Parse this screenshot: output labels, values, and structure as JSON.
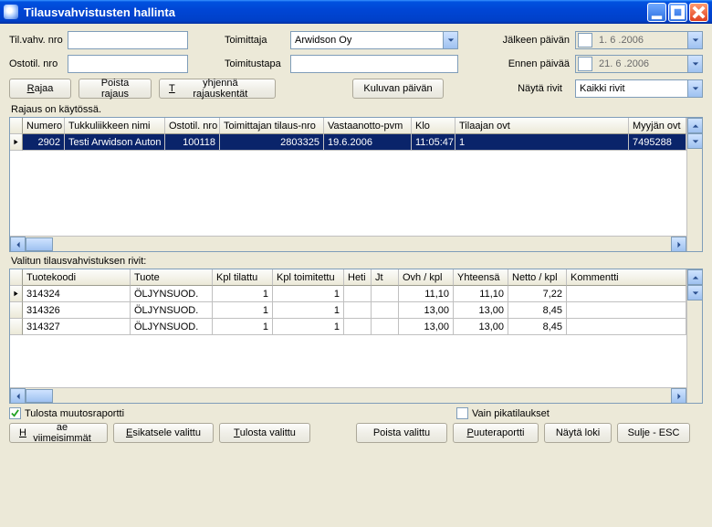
{
  "window": {
    "title": "Tilausvahvistusten hallinta"
  },
  "filters": {
    "tilvahv_label": "Til.vahv. nro",
    "tilvahv_value": "",
    "ostotil_label": "Ostotil. nro",
    "ostotil_value": "",
    "toimittaja_label": "Toimittaja",
    "toimittaja_value": "Arwidson Oy",
    "toimitustapa_label": "Toimitustapa",
    "toimitustapa_value": "",
    "jalkeen_label": "Jälkeen päivän",
    "jalkeen_value": "1. 6 .2006",
    "ennen_label": "Ennen päivää",
    "ennen_value": "21. 6 .2006",
    "nayta_rivit_label": "Näytä rivit",
    "nayta_rivit_value": "Kaikki rivit"
  },
  "buttons": {
    "rajaa": "Rajaa",
    "poista_rajaus": "Poista rajaus",
    "tyhjenna": "Tyhjennä rajauskentät",
    "kuluvan": "Kuluvan päivän"
  },
  "status": {
    "filter_on": "Rajaus on käytössä."
  },
  "grid1": {
    "headers": {
      "numero": "Numero",
      "tukkuliikkeen_nimi": "Tukkuliikkeen nimi",
      "ostotil_nro": "Ostotil. nro",
      "toimittajan_tilausnro": "Toimittajan tilaus-nro",
      "vastaanotto_pvm": "Vastaanotto-pvm",
      "klo": "Klo",
      "tilaajan_ovt": "Tilaajan ovt",
      "myyjan_ovt": "Myyjän ovt"
    },
    "rows": [
      {
        "numero": "2902",
        "tukkuliikkeen_nimi": "Testi Arwidson Auton",
        "ostotil_nro": "100118",
        "toimittajan_tilausnro": "2803325",
        "vastaanotto_pvm": "19.6.2006",
        "klo": "11:05:47",
        "tilaajan_ovt": "1",
        "myyjan_ovt": "7495288"
      }
    ]
  },
  "section2_label": "Valitun tilausvahvistuksen rivit:",
  "grid2": {
    "headers": {
      "tuotekoodi": "Tuotekoodi",
      "tuote": "Tuote",
      "kpl_tilattu": "Kpl tilattu",
      "kpl_toimitettu": "Kpl toimitettu",
      "heti": "Heti",
      "jt": "Jt",
      "ovh_kpl": "Ovh / kpl",
      "yhteensa": "Yhteensä",
      "netto_kpl": "Netto / kpl",
      "kommentti": "Kommentti"
    },
    "rows": [
      {
        "tuotekoodi": "314324",
        "tuote": "ÖLJYNSUOD.",
        "kpl_tilattu": "1",
        "kpl_toimitettu": "1",
        "heti": "",
        "jt": "",
        "ovh": "11,10",
        "yhteensa": "11,10",
        "netto": "7,22",
        "kommentti": ""
      },
      {
        "tuotekoodi": "314326",
        "tuote": "ÖLJYNSUOD.",
        "kpl_tilattu": "1",
        "kpl_toimitettu": "1",
        "heti": "",
        "jt": "",
        "ovh": "13,00",
        "yhteensa": "13,00",
        "netto": "8,45",
        "kommentti": ""
      },
      {
        "tuotekoodi": "314327",
        "tuote": "ÖLJYNSUOD.",
        "kpl_tilattu": "1",
        "kpl_toimitettu": "1",
        "heti": "",
        "jt": "",
        "ovh": "13,00",
        "yhteensa": "13,00",
        "netto": "8,45",
        "kommentti": ""
      }
    ]
  },
  "bottom": {
    "tulosta_muutos": "Tulosta muutosraportti",
    "vain_pikatilaukset": "Vain pikatilaukset",
    "hae_viimeisimmat": "Hae viimeisimmät",
    "esikatsele": "Esikatsele valittu",
    "tulosta_valittu": "Tulosta valittu",
    "poista_valittu": "Poista valittu",
    "puuteraportti": "Puuteraportti",
    "nayta_loki": "Näytä loki",
    "sulje": "Sulje - ESC"
  }
}
